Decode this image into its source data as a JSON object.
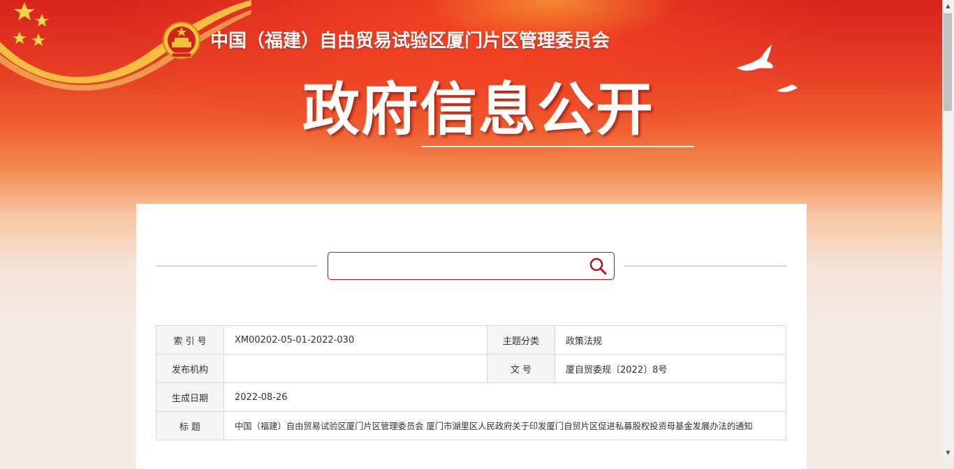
{
  "header": {
    "site_title": "中国（福建）自由贸易试验区厦门片区管理委员会",
    "main_title": "政府信息公开"
  },
  "search": {
    "placeholder": "",
    "value": ""
  },
  "meta": {
    "index_label": "索 引 号",
    "index_value": "XM00202-05-01-2022-030",
    "category_label": "主题分类",
    "category_value": "政策法规",
    "publisher_label": "发布机构",
    "publisher_value": "",
    "docno_label": "文 号",
    "docno_value": "厦自贸委规〔2022〕8号",
    "date_label": "生成日期",
    "date_value": "2022-08-26",
    "title_label": "标 题",
    "title_value": "中国（福建）自由贸易试验区厦门片区管理委员会 厦门市湖里区人民政府关于印发厦门自贸片区促进私募股权投资母基金发展办法的通知"
  },
  "colors": {
    "banner_red": "#d6241c",
    "accent_red": "#b8120f",
    "gold": "#f5c542"
  },
  "icons": {
    "emblem": "national-emblem-icon",
    "search": "search-icon",
    "doves": "dove-icon"
  }
}
